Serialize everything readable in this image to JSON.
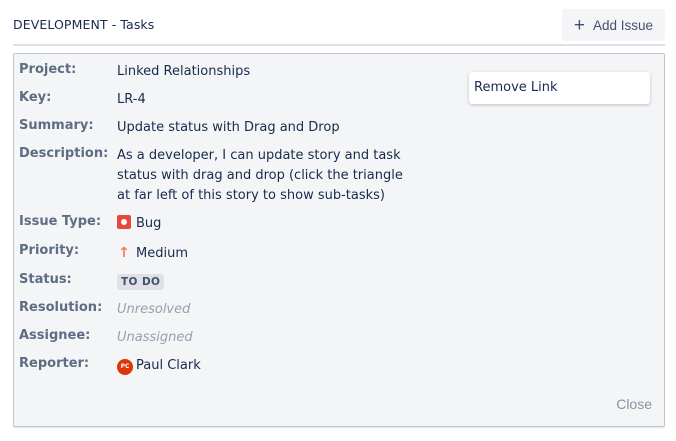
{
  "header": {
    "title": "DEVELOPMENT - Tasks",
    "add_issue_label": "Add Issue",
    "add_icon": "plus-icon"
  },
  "details": {
    "project": {
      "label": "Project:",
      "value": "Linked Relationships"
    },
    "key": {
      "label": "Key:",
      "value": "LR-4"
    },
    "summary": {
      "label": "Summary:",
      "value": "Update status with Drag and Drop"
    },
    "description": {
      "label": "Description:",
      "value": "As a developer, I can update story and task status with drag and drop (click the triangle at far left of this story to show sub-tasks)"
    },
    "issue_type": {
      "label": "Issue Type:",
      "value": "Bug",
      "icon": "bug-icon",
      "color": "#e5493a"
    },
    "priority": {
      "label": "Priority:",
      "value": "Medium",
      "icon": "priority-medium-icon",
      "color": "#ff7452"
    },
    "status": {
      "label": "Status:",
      "value": "TO DO"
    },
    "resolution": {
      "label": "Resolution:",
      "value": "Unresolved"
    },
    "assignee": {
      "label": "Assignee:",
      "value": "Unassigned"
    },
    "reporter": {
      "label": "Reporter:",
      "value": "Paul Clark",
      "avatar_initials": "PC",
      "avatar_color": "#de350b"
    }
  },
  "actions": {
    "remove_link": "Remove Link",
    "close": "Close"
  }
}
